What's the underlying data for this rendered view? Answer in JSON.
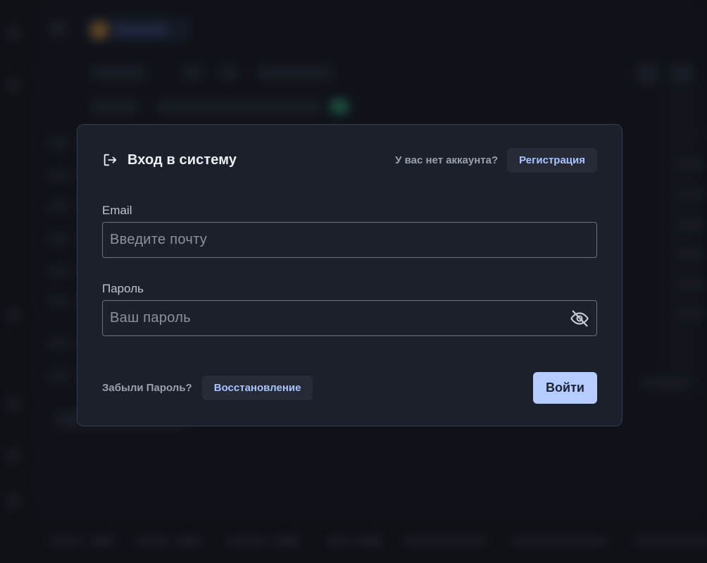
{
  "login": {
    "title": "Вход в систему",
    "title_icon": "login-icon",
    "no_account_text": "У вас нет аккаунта?",
    "register_label": "Регистрация",
    "email": {
      "label": "Email",
      "placeholder": "Введите почту",
      "value": ""
    },
    "password": {
      "label": "Пароль",
      "placeholder": "Ваш пароль",
      "value": "",
      "toggle_icon": "eye-off-icon"
    },
    "forgot_text": "Забыли Пароль?",
    "restore_label": "Восстановление",
    "submit_label": "Войти"
  },
  "colors": {
    "accent": "#b6cbff",
    "link": "#a9c3ff",
    "modal_bg": "#1c202a",
    "page_bg": "#12141b"
  }
}
